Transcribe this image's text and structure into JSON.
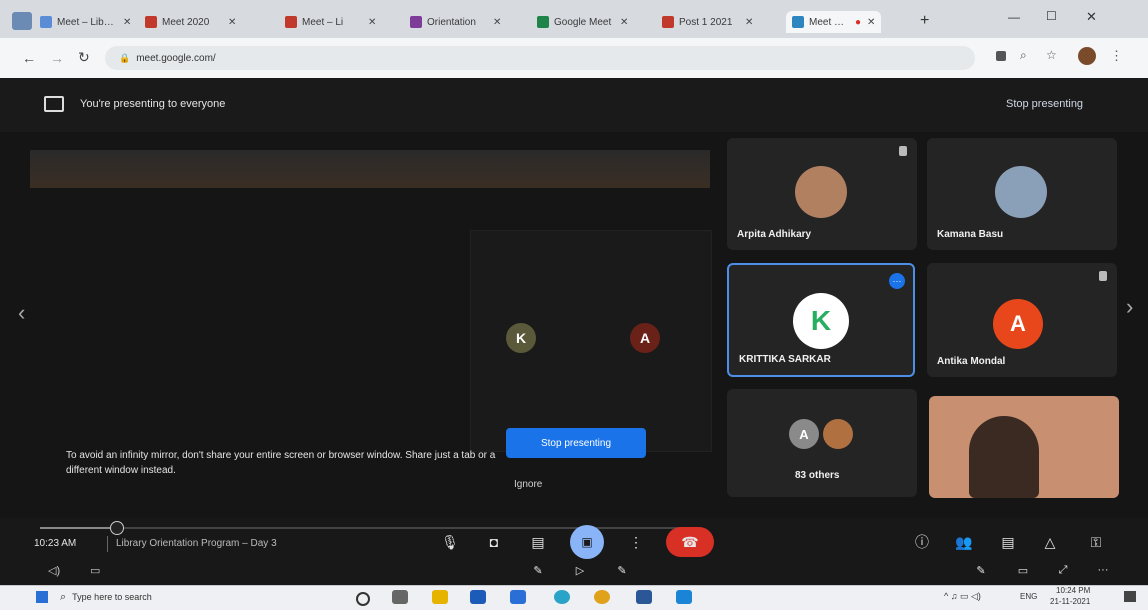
{
  "browser": {
    "tabs": [
      {
        "label": "Meet – Library",
        "color": "#5a8dd6"
      },
      {
        "label": "Meet 2020",
        "color": "#c0392b"
      },
      {
        "label": "Meet – Li",
        "color": "#c0392b"
      },
      {
        "label": "Orientation",
        "color": "#7d3c98"
      },
      {
        "label": "Google Meet",
        "color": "#1e8449"
      },
      {
        "label": "Post 1 2021",
        "color": "#c0392b"
      },
      {
        "label": "Meet – Lib",
        "color": "#2e86c1"
      }
    ],
    "new_tab": "+",
    "url": "meet.google.com/"
  },
  "presenting_banner": {
    "text": "You're presenting to everyone",
    "stop_link": "Stop presenting"
  },
  "main": {
    "warning_text": "To avoid an infinity mirror, don't share your entire screen or browser window. Share just a tab or a different window instead.",
    "stop_button": "Stop presenting",
    "ignore_button": "Ignore"
  },
  "participants": [
    {
      "name": "Arpita Adhikary",
      "initial": "",
      "color": "#b08060"
    },
    {
      "name": "Kamana Basu",
      "initial": "",
      "color": "#8aa0b8"
    },
    {
      "name": "KRITTIKA SARKAR",
      "initial": "K",
      "color": "#ffffff"
    },
    {
      "name": "Antika Mondal",
      "initial": "A",
      "color": "#e8471c"
    },
    {
      "name": "83 others",
      "initial": "A",
      "color": "#8a8a8a"
    },
    {
      "name": "",
      "initial": "",
      "color": "#c89070"
    }
  ],
  "bottom": {
    "time": "10:23 AM",
    "meeting_title": "Library Orientation Program – Day 3"
  },
  "taskbar": {
    "search_placeholder": "Type here to search",
    "clock_time": "10:24 PM",
    "clock_date": "21-11-2021",
    "lang": "ENG"
  },
  "colors": {
    "accent": "#1a73e8",
    "end_call": "#d93025",
    "background": "#151515"
  },
  "icons": [
    "present-icon",
    "chevron-left-icon",
    "chevron-right-icon",
    "mic-icon",
    "camera-icon",
    "captions-icon",
    "present-now-icon",
    "more-icon",
    "end-call-icon",
    "info-icon",
    "people-icon",
    "chat-icon",
    "activities-icon",
    "lock-icon",
    "windows-icon",
    "search-icon"
  ]
}
